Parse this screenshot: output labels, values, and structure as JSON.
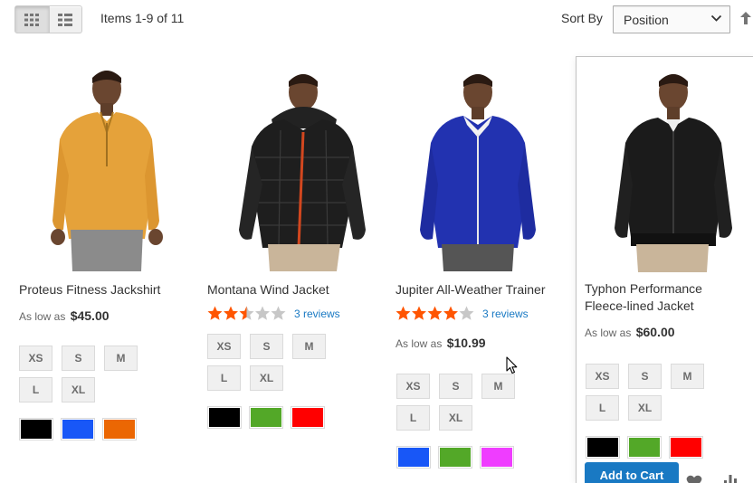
{
  "toolbar": {
    "view_modes": [
      {
        "name": "Grid",
        "icon": "grid-icon",
        "active": true
      },
      {
        "name": "List",
        "icon": "list-icon",
        "active": false
      }
    ],
    "items_count": "Items 1-9 of 11",
    "sort_label": "Sort By",
    "sort_value": "Position",
    "sort_icon": "sort-direction-arrow-icon"
  },
  "colors": {
    "accent": "#1979c3",
    "star_filled": "#ff5501",
    "star_empty": "#c7c7c7"
  },
  "products": [
    {
      "name": "Proteus Fitness Jackshirt",
      "price_label": "As low as",
      "price": "$45.00",
      "rating": null,
      "sizes": [
        "XS",
        "S",
        "M",
        "L",
        "XL"
      ],
      "colors": [
        "#000000",
        "#1857f7",
        "#eb6703"
      ]
    },
    {
      "name": "Montana Wind Jacket",
      "price_label": "",
      "price": "",
      "rating": 2.5,
      "reviews": "3 reviews",
      "sizes": [
        "XS",
        "S",
        "M",
        "L",
        "XL"
      ],
      "colors": [
        "#000000",
        "#53a828",
        "#ff0000"
      ]
    },
    {
      "name": "Jupiter All-Weather Trainer",
      "price_label": "As low as",
      "price": "$10.99",
      "rating": 4,
      "reviews": "3 reviews",
      "sizes": [
        "XS",
        "S",
        "M",
        "L",
        "XL"
      ],
      "colors": [
        "#1857f7",
        "#53a828",
        "#ef3dff"
      ]
    },
    {
      "name_line1": "Typhon Performance",
      "name_line2": "Fleece-lined Jacket",
      "price_label": "As low as",
      "price": "$60.00",
      "rating": null,
      "sizes": [
        "XS",
        "S",
        "M",
        "L",
        "XL"
      ],
      "colors": [
        "#000000",
        "#53a828",
        "#ff0000"
      ],
      "add_to_cart": "Add to Cart",
      "hovered": true
    }
  ]
}
